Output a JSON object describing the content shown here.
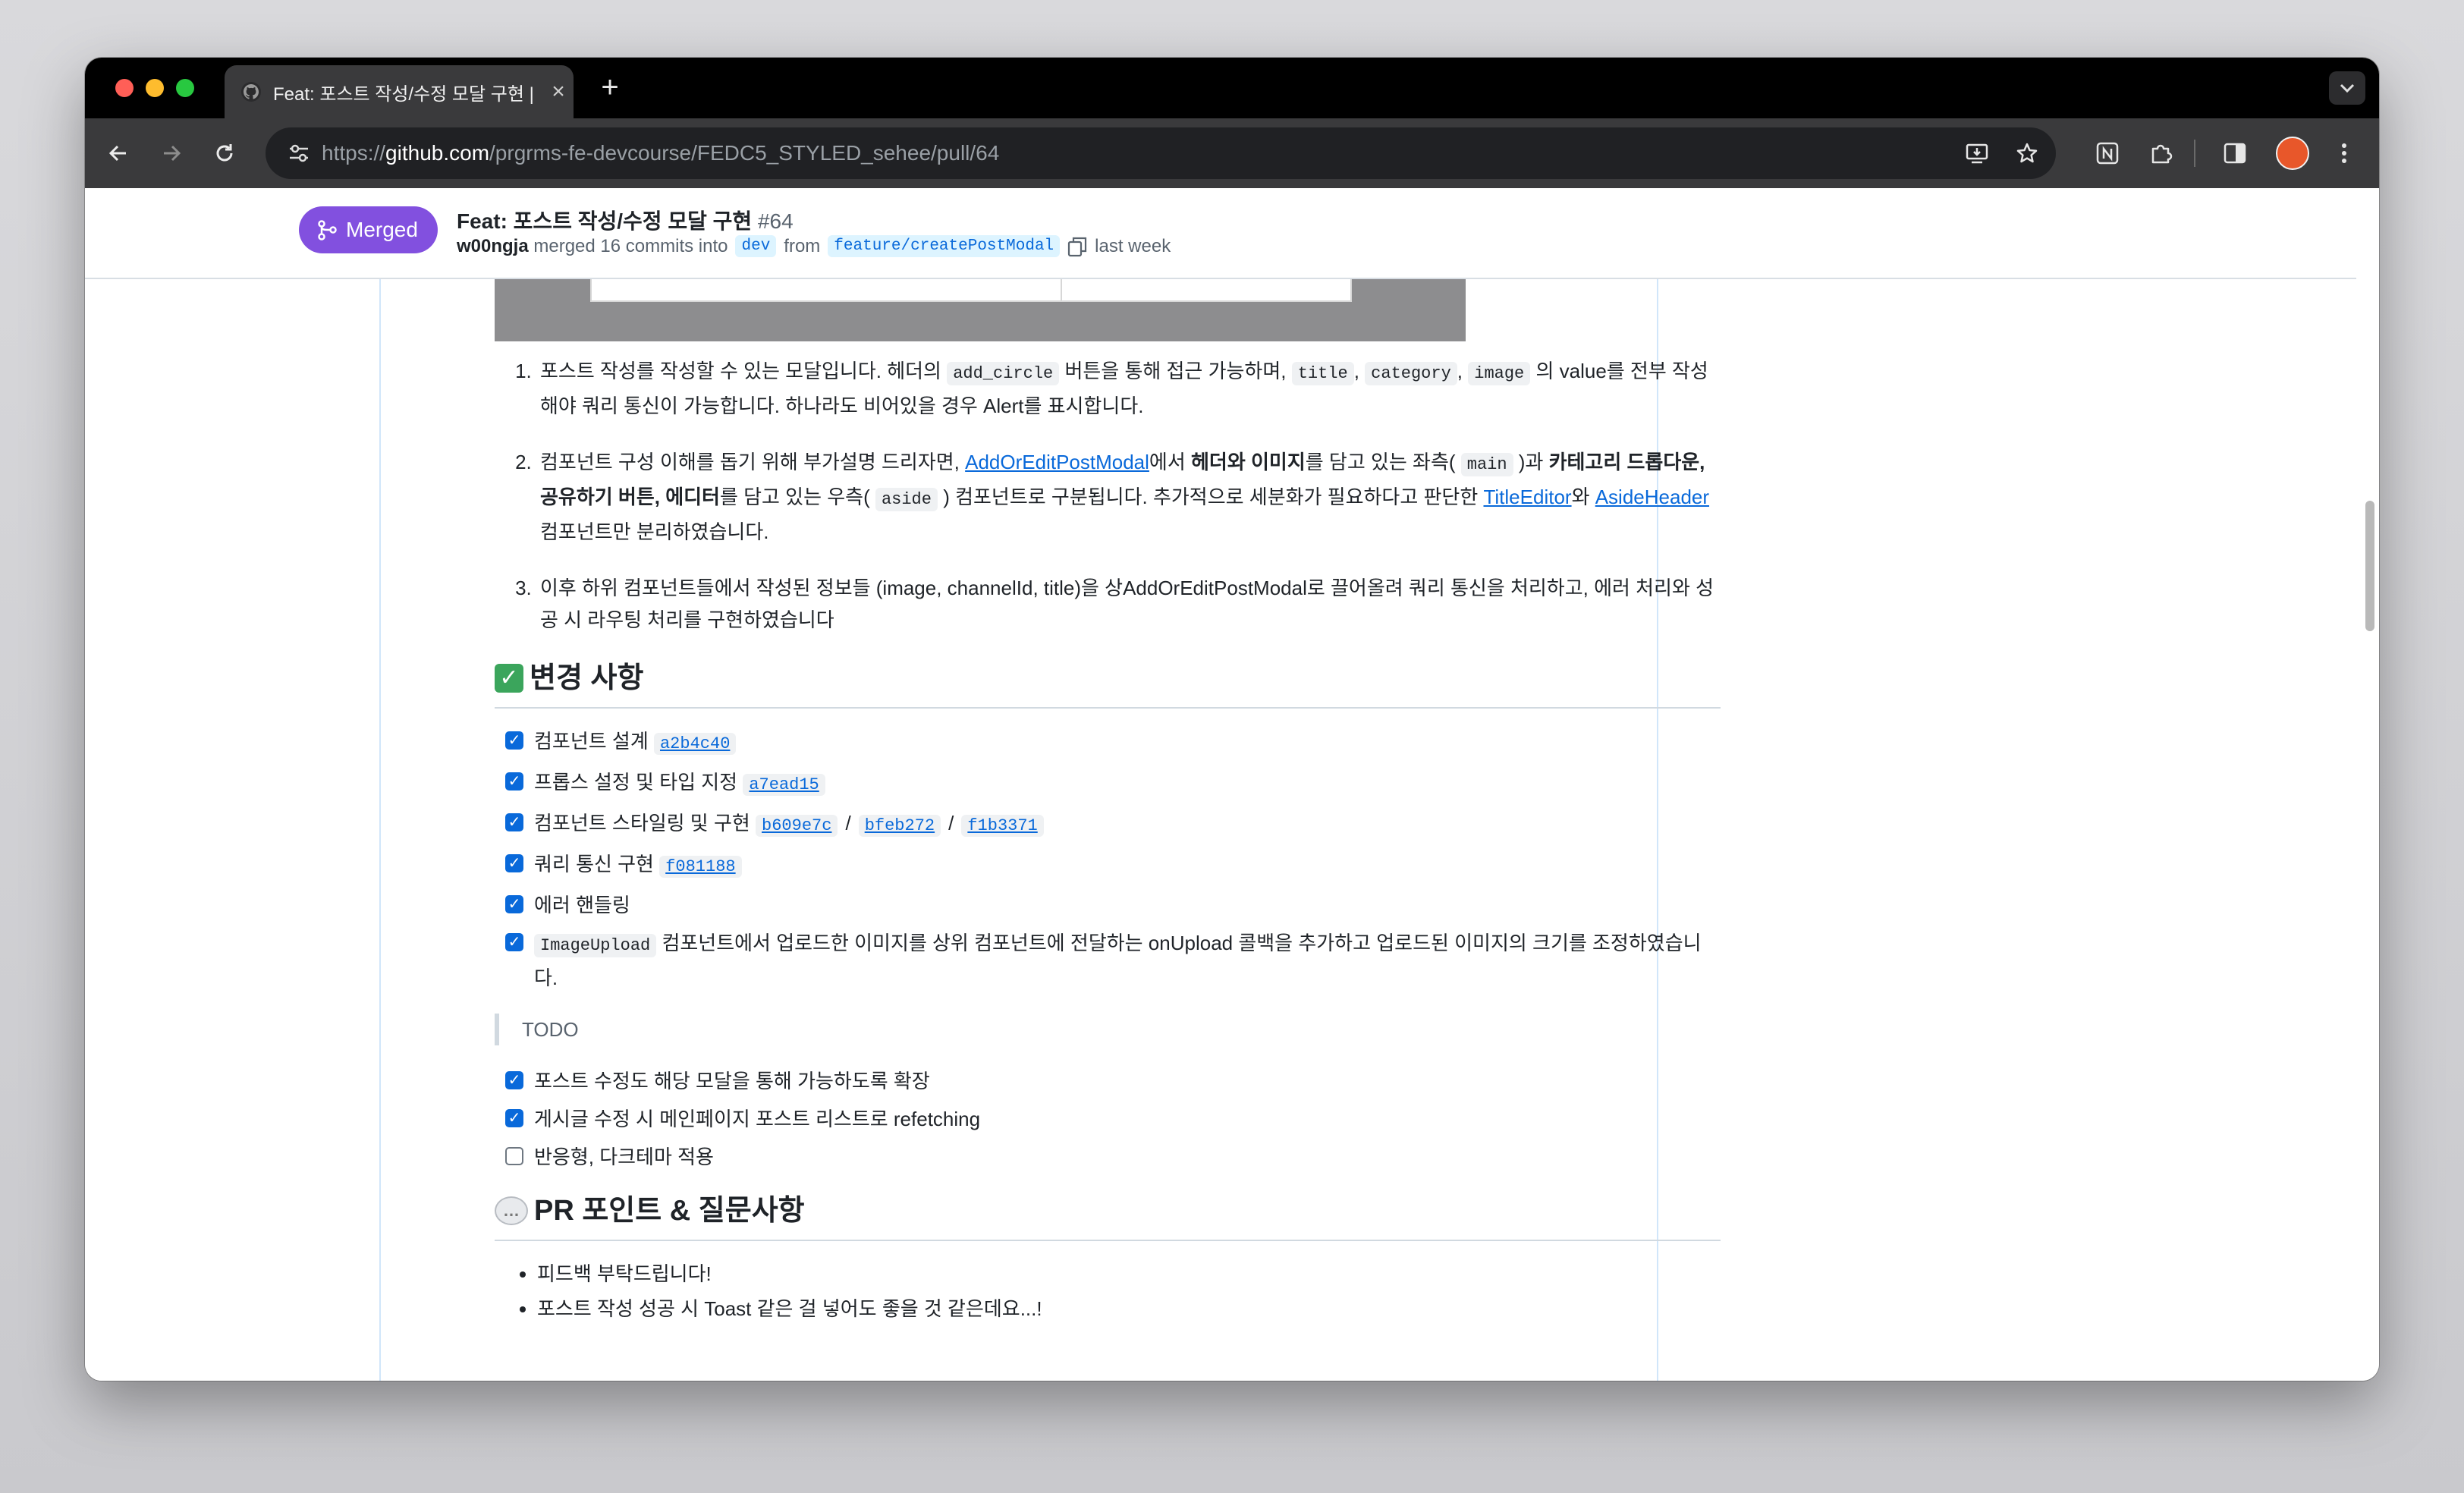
{
  "tab": {
    "title": "Feat: 포스트 작성/수정 모달 구현 |"
  },
  "omnibox": {
    "url_prefix": "https://",
    "url_host": "github.com",
    "url_path": "/prgrms-fe-devcourse/FEDC5_STYLED_sehee/pull/64"
  },
  "pr": {
    "state": "Merged",
    "title": "Feat: 포스트 작성/수정 모달 구현",
    "number": "#64",
    "author": "w00ngja",
    "merge_text": "merged 16 commits into",
    "base_branch": "dev",
    "from_text": "from",
    "head_branch": "feature/createPostModal",
    "time": "last week"
  },
  "desc": {
    "item1": {
      "t1": "포스트 작성를 작성할 수 있는 모달입니다. 헤더의 ",
      "c1": "add_circle",
      "t2": " 버튼을 통해 접근 가능하며, ",
      "c2": "title",
      "t3": ", ",
      "c3": "category",
      "t4": ", ",
      "c4": "image",
      "t5": " 의 value를 전부 작성해야 쿼리 통신이 가능합니다. 하나라도 비어있을 경우 Alert를 표시합니다."
    },
    "item2": {
      "t1": "컴포넌트 구성 이해를 돕기 위해 부가설명 드리자면, ",
      "l1": "AddOrEditPostModal",
      "t2": "에서 ",
      "b1": "헤더와 이미지",
      "t3": "를 담고 있는 좌측( ",
      "c1": "main",
      "t4": " )과 ",
      "b2": "카테고리 드롭다운, 공유하기 버튼, 에디터",
      "t5": "를 담고 있는 우측( ",
      "c2": "aside",
      "t6": " ) 컴포넌트로 구분됩니다. 추가적으로 세분화가 필요하다고 판단한 ",
      "l2": "TitleEditor",
      "t7": "와 ",
      "l3": "AsideHeader",
      "t8": " 컴포넌트만 분리하였습니다."
    },
    "item3": "이후 하위 컴포넌트들에서 작성된 정보들 (image, channelId, title)을 상AddOrEditPostModal로 끌어올려 쿼리 통신을 처리하고, 에러 처리와 성공 시 라우팅 처리를 구현하였습니다"
  },
  "changes": {
    "heading": "변경 사항",
    "tasks": [
      {
        "label": "컴포넌트 설계",
        "shas": [
          "a2b4c40"
        ]
      },
      {
        "label": "프롭스 설정 및 타입 지정",
        "shas": [
          "a7ead15"
        ]
      },
      {
        "label": "컴포넌트 스타일링 및 구현",
        "shas": [
          "b609e7c",
          "bfeb272",
          "f1b3371"
        ]
      },
      {
        "label": "쿼리 통신 구현",
        "shas": [
          "f081188"
        ]
      },
      {
        "label": "에러 핸들링",
        "shas": []
      }
    ],
    "upload_task": {
      "code": "ImageUpload",
      "text": " 컴포넌트에서 업로드한 이미지를 상위 컴포넌트에 전달하는 onUpload 콜백을 추가하고 업로드된 이미지의 크기를 조정하였습니다."
    },
    "sha_separator": "/",
    "todo_label": "TODO",
    "todo_tasks": [
      {
        "label": "포스트 수정도 해당 모달을 통해 가능하도록 확장",
        "checked": true
      },
      {
        "label": "게시글 수정 시 메인페이지 포스트 리스트로 refetching",
        "checked": true
      },
      {
        "label": "반응형, 다크테마 적용",
        "checked": false
      }
    ]
  },
  "pr_points": {
    "heading": "PR 포인트 & 질문사항",
    "bullets": [
      "피드백 부탁드립니다!",
      "포스트 작성 성공 시 Toast 같은 걸 넣어도 좋을 것 같은데요...!"
    ]
  },
  "colors": {
    "merged": "#8250df",
    "link": "#0969da",
    "checkbox": "#0969da"
  }
}
